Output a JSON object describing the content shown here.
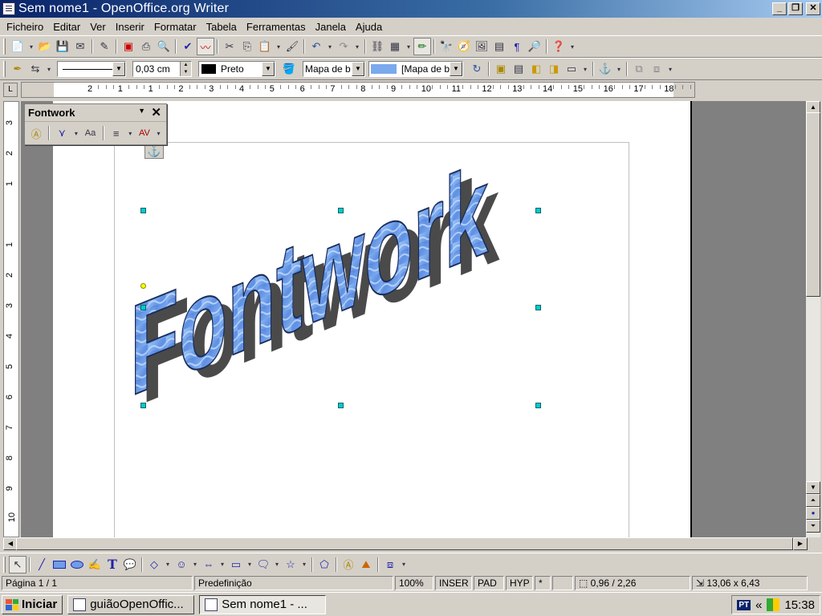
{
  "window": {
    "title": "Sem nome1 - OpenOffice.org Writer"
  },
  "menu": [
    "Ficheiro",
    "Editar",
    "Ver",
    "Inserir",
    "Formatar",
    "Tabela",
    "Ferramentas",
    "Janela",
    "Ajuda"
  ],
  "menu_underline": [
    "F",
    "E",
    "V",
    "I",
    "F",
    "T",
    "r",
    "J",
    "A"
  ],
  "toolbar2": {
    "line_width": "0,03 cm",
    "line_color": "Preto",
    "area_style": "Mapa de b",
    "area_fill": "[Mapa de b"
  },
  "ruler_h": [
    "2",
    "1",
    "1",
    "2",
    "3",
    "4",
    "5",
    "6",
    "7",
    "8",
    "9",
    "10",
    "11",
    "12",
    "13",
    "14",
    "15",
    "16",
    "17",
    "18"
  ],
  "ruler_v": [
    "3",
    "2",
    "1",
    "1",
    "2",
    "3",
    "4",
    "5",
    "6",
    "7",
    "8",
    "9",
    "10"
  ],
  "fontwork_toolbar": {
    "title": "Fontwork"
  },
  "fontwork_text": "Fontwork",
  "status": {
    "page": "Página 1 / 1",
    "style": "Predefinição",
    "zoom": "100%",
    "insert": "INSER",
    "selection": "PAD",
    "hyphen": "HYP",
    "modified": "*",
    "position": "0,96 / 2,26",
    "size": "13,06 x 6,43"
  },
  "taskbar": {
    "start": "Iniciar",
    "tasks": [
      "guiãoOpenOffic...",
      "Sem nome1 - ..."
    ],
    "lang": "PT",
    "clock": "15:38"
  },
  "colors": {
    "titlebar_start": "#0a246a",
    "fontwork_fill": "#6e9ee8",
    "fontwork_shadow": "#4a4a4a",
    "handle": "#00cccc"
  }
}
